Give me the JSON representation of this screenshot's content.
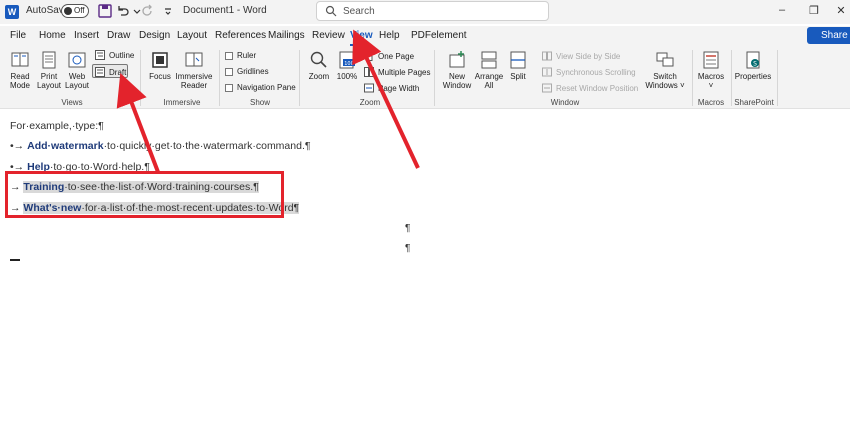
{
  "titlebar": {
    "app_icon": "W",
    "autosave_label": "AutoSave",
    "autosave_state": "Off",
    "doc_title": "Document1 - Word",
    "search_placeholder": "Search",
    "share_label": "Share"
  },
  "tabs": [
    "File",
    "Home",
    "Insert",
    "Draw",
    "Design",
    "Layout",
    "References",
    "Mailings",
    "Review",
    "View",
    "Help",
    "PDFelement"
  ],
  "active_tab": "View",
  "ribbon": {
    "views": {
      "label": "Views",
      "read_mode": [
        "Read",
        "Mode"
      ],
      "print_layout": [
        "Print",
        "Layout"
      ],
      "web_layout": [
        "Web",
        "Layout"
      ],
      "outline": "Outline",
      "draft": "Draft"
    },
    "immersive": {
      "label": "Immersive",
      "focus": "Focus",
      "immersive_reader": [
        "Immersive",
        "Reader"
      ]
    },
    "show": {
      "label": "Show",
      "ruler": "Ruler",
      "gridlines": "Gridlines",
      "navigation_pane": "Navigation Pane"
    },
    "zoom": {
      "label": "Zoom",
      "zoom": "Zoom",
      "hundred": "100%",
      "one_page": "One Page",
      "multiple_pages": "Multiple Pages",
      "page_width": "Page Width"
    },
    "window": {
      "label": "Window",
      "new_window": [
        "New",
        "Window"
      ],
      "arrange_all": [
        "Arrange",
        "All"
      ],
      "split": "Split",
      "view_side_by_side": "View Side by Side",
      "synchronous_scrolling": "Synchronous Scrolling",
      "reset_window_position": "Reset Window Position",
      "switch_windows": [
        "Switch",
        "Windows"
      ]
    },
    "macros": {
      "label": "Macros",
      "macros": "Macros"
    },
    "sharepoint": {
      "label": "SharePoint",
      "properties": "Properties"
    }
  },
  "document": {
    "intro": "For·example,·type:¶",
    "items": [
      {
        "bullet": "•→",
        "bold": "Add·watermark",
        "rest": "·to·quickly·get·to·the·watermark·command.¶"
      },
      {
        "bullet": "•→",
        "bold": "Help",
        "rest": "·to·go·to·Word·help.¶"
      },
      {
        "bullet": "→",
        "bold": "Training",
        "rest": "·to·see·the·list·of·Word·training·courses.¶"
      },
      {
        "bullet": "→",
        "bold": "What's·new",
        "rest": "·for·a·list·of·the·most·recent·updates·to·Word¶"
      }
    ],
    "pilcrow": "¶"
  },
  "colors": {
    "accent": "#185abd",
    "annotation": "#e3232c"
  }
}
